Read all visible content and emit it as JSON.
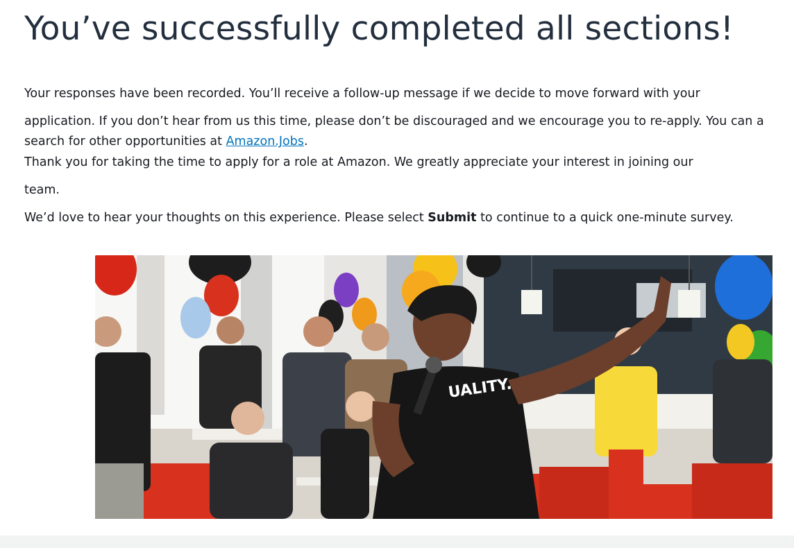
{
  "page": {
    "title": "You’ve successfully completed all sections!",
    "paragraph_1_line_1": "Your responses have been recorded. You’ll receive a follow-up message if we decide to move forward with your",
    "paragraph_1_line_2": "application. If you don’t hear from us this time, please don’t be discouraged and we encourage you to re-apply. You can a",
    "paragraph_1_line_3_prefix": "search for other opportunities at ",
    "jobs_link": "Amazon.Jobs",
    "paragraph_1_line_3_suffix": ".",
    "paragraph_2_line_1": "Thank you for taking the time to apply for a role at Amazon. We greatly appreciate your interest in joining our",
    "paragraph_2_line_2": "team.",
    "survey_prefix": "We’d love to hear your thoughts on this experience. Please select ",
    "survey_bold": "Submit",
    "survey_suffix": " to continue to a quick one-minute survey.",
    "shirt_text": "UALITY."
  },
  "colors": {
    "title": "#232f3e",
    "link": "#0073bb",
    "footer_band": "#f2f3f3"
  }
}
